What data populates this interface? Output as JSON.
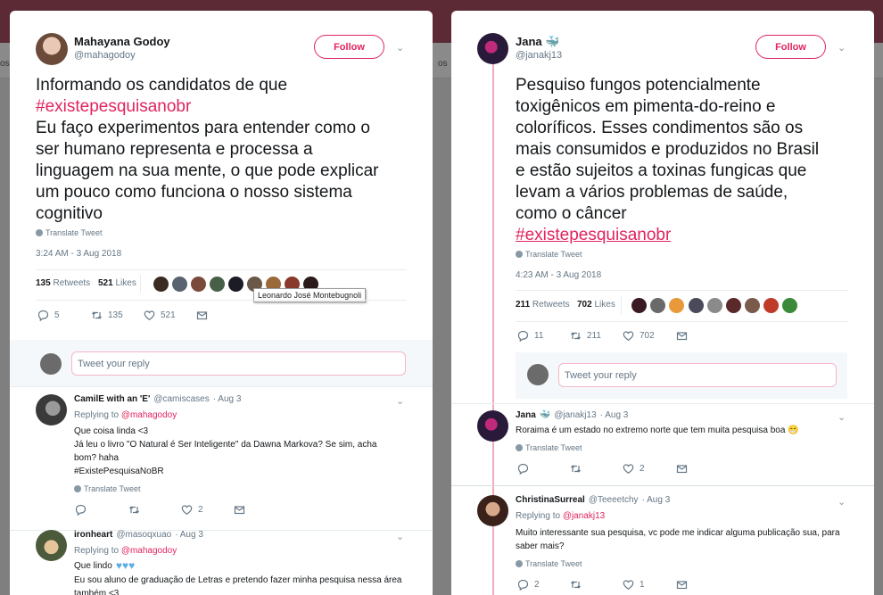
{
  "background": {
    "left_text": "os",
    "right_text": "os"
  },
  "left": {
    "author": {
      "name": "Mahayana Godoy",
      "handle": "@mahagodoy"
    },
    "follow_label": "Follow",
    "text_lines": [
      "Informando os candidatos de que",
      "#existepesquisanobr",
      "Eu faço experimentos para entender como o",
      "ser humano representa e processa a",
      "linguagem na sua mente, o que pode explicar",
      "um pouco como funciona o nosso sistema",
      "cognitivo"
    ],
    "translate": "Translate Tweet",
    "timestamp": "3:24 AM - 3 Aug 2018",
    "retweets_count": "135",
    "retweets_label": "Retweets",
    "likes_count": "521",
    "likes_label": "Likes",
    "tooltip": "Leonardo José Montebugnoli",
    "actions": {
      "reply": "5",
      "retweet": "135",
      "like": "521"
    },
    "reply_placeholder": "Tweet your reply",
    "replies": [
      {
        "name": "CamilE with an 'E'",
        "handle": "@camiscases",
        "date": "· Aug 3",
        "replying_prefix": "Replying to",
        "replying_to": "@mahagodoy",
        "lines": [
          "Que coisa linda <3",
          "Já leu o livro \"O Natural é Ser Inteligente\" da Dawna Markova? Se sim, acha",
          "bom? haha"
        ],
        "hashtag": "#ExistePesquisaNoBR",
        "translate": "Translate Tweet",
        "likes": "2"
      },
      {
        "name": "ironheart",
        "handle": "@masoqxuao",
        "date": "· Aug 3",
        "replying_prefix": "Replying to",
        "replying_to": "@mahagodoy",
        "lines": [
          "Que lindo",
          "Eu sou aluno de graduação de Letras e pretendo fazer minha pesquisa nessa área",
          "também <3"
        ]
      }
    ]
  },
  "right": {
    "author": {
      "name": "Jana",
      "handle": "@janakj13",
      "emoji": "🐳"
    },
    "follow_label": "Follow",
    "text_lines": [
      "Pesquiso fungos potencialmente",
      "toxigênicos em pimenta-do-reino e",
      "coloríficos. Esses condimentos são os",
      "mais consumidos e produzidos no Brasil",
      "e estão sujeitos a toxinas fungicas que",
      "levam a vários problemas de saúde,",
      "como o câncer",
      "#existepesquisanobr"
    ],
    "translate": "Translate Tweet",
    "timestamp": "4:23 AM - 3 Aug 2018",
    "retweets_count": "211",
    "retweets_label": "Retweets",
    "likes_count": "702",
    "likes_label": "Likes",
    "actions": {
      "reply": "11",
      "retweet": "211",
      "like": "702"
    },
    "reply_placeholder": "Tweet your reply",
    "replies": [
      {
        "name": "Jana",
        "emoji": "🐳",
        "handle": "@janakj13",
        "date": "· Aug 3",
        "text": "Roraima é um estado no extremo norte que tem muita pesquisa boa 😁",
        "translate": "Translate Tweet",
        "likes": "2"
      },
      {
        "name": "ChristinaSurreal",
        "handle": "@Teeeetchy",
        "date": "· Aug 3",
        "replying_prefix": "Replying to",
        "replying_to": "@janakj13",
        "lines": [
          "Muito interessante sua pesquisa, vc pode me indicar alguma publicação sua, para",
          "saber mais?"
        ],
        "translate": "Translate Tweet",
        "actions": {
          "reply": "2",
          "like": "1"
        }
      }
    ]
  },
  "colors": {
    "accent": "#e0245e",
    "muted": "#657786",
    "border": "#e6ecf0"
  }
}
